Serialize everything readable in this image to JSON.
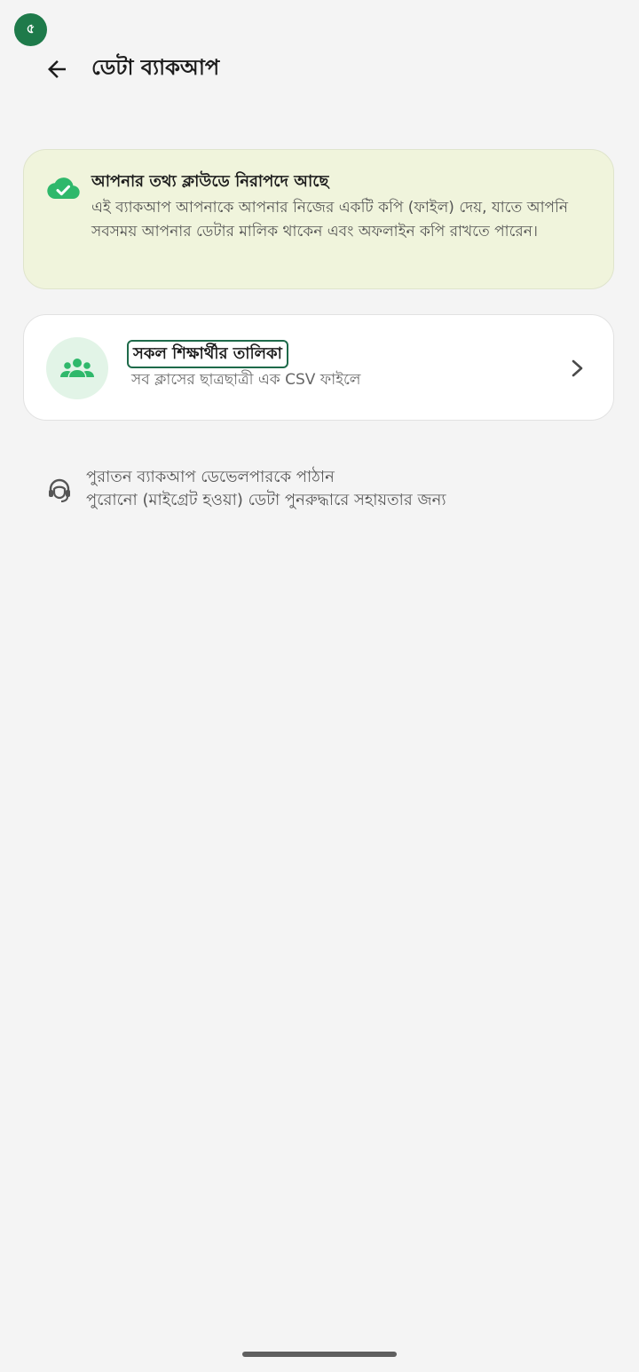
{
  "status_bar": {
    "app_badge_glyph": "৫"
  },
  "header": {
    "title": "ডেটা ব্যাকআপ"
  },
  "info_card": {
    "title": "আপনার তথ্য ক্লাউডে নিরাপদে আছে",
    "body": "এই ব্যাকআপ আপনাকে আপনার নিজের একটি কপি (ফাইল) দেয়, যাতে আপনি সবসময় আপনার ডেটার মালিক থাকেন এবং অফলাইন কপি রাখতে পারেন।",
    "icon": "cloud-check-icon",
    "accent_color": "#2fb86b",
    "background_color": "#f0f4dc"
  },
  "students_card": {
    "title": "সকল শিক্ষার্থীর তালিকা",
    "subtitle": "সব ক্লাসের ছাত্রছাত্রী এক CSV ফাইলে",
    "icon": "group-icon",
    "trailing_icon": "chevron-right-icon",
    "accent_color": "#2fb86b"
  },
  "legacy": {
    "title": "পুরাতন ব্যাকআপ ডেভেলপারকে পাঠান",
    "subtitle": "পুরোনো (মাইগ্রেট হওয়া) ডেটা পুনরুদ্ধারে সহায়তার জন্য",
    "icon": "support-agent-icon"
  }
}
